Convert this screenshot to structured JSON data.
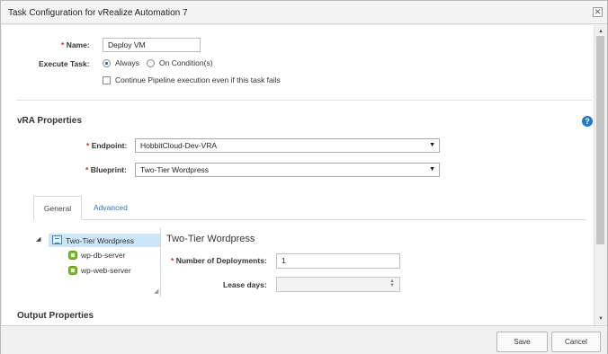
{
  "dialog": {
    "title": "Task Configuration for vRealize Automation 7",
    "close_symbol": "✕"
  },
  "task": {
    "name_label": "Name:",
    "name_value": "Deploy VM",
    "execute_label": "Execute Task:",
    "execute_options": [
      {
        "label": "Always",
        "selected": true
      },
      {
        "label": "On Condition(s)",
        "selected": false
      }
    ],
    "continue_label": "Continue Pipeline execution even if this task fails",
    "continue_checked": false,
    "required_mark": "*"
  },
  "vra": {
    "section_title": "vRA Properties",
    "help_symbol": "?",
    "endpoint_label": "Endpoint:",
    "endpoint_value": "HobbitCloud-Dev-VRA",
    "blueprint_label": "Blueprint:",
    "blueprint_value": "Two-Tier Wordpress",
    "dropdown_arrow": "▼"
  },
  "tabs": [
    {
      "label": "General",
      "active": true
    },
    {
      "label": "Advanced",
      "active": false
    }
  ],
  "tree": {
    "toggle_symbol": "◢",
    "root": "Two-Tier Wordpress",
    "children": [
      "wp-db-server",
      "wp-web-server"
    ],
    "grip_symbol": "◢"
  },
  "detail": {
    "title": "Two-Tier Wordpress",
    "deployments_label": "Number of Deployments:",
    "deployments_value": "1",
    "lease_label": "Lease days:",
    "lease_value": ""
  },
  "output": {
    "section_title": "Output Properties"
  },
  "footer": {
    "save_label": "Save",
    "cancel_label": "Cancel"
  },
  "scrollbar": {
    "up_symbol": "▲",
    "down_symbol": "▼"
  },
  "colors": {
    "required": "#d0281e",
    "link": "#2a78c4",
    "help": "#2478c8",
    "tree_selection": "#cde6f7",
    "vm_icon": "#7cbb2b"
  }
}
